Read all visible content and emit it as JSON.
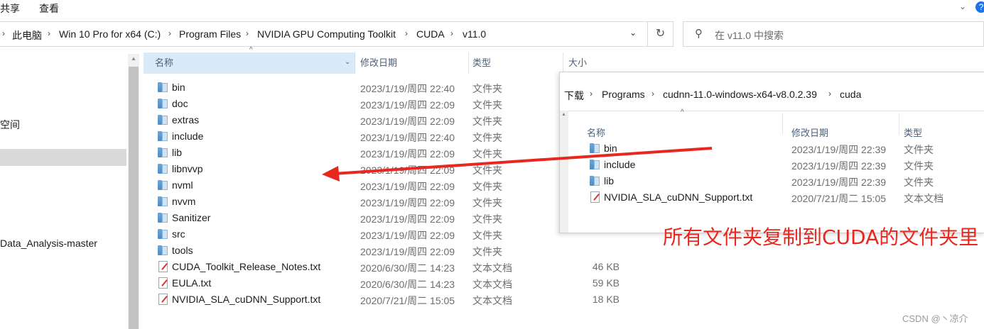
{
  "ribbon": {
    "tabs": [
      "共享",
      "查看"
    ]
  },
  "address": {
    "breadcrumbs": [
      "此电脑",
      "Win 10 Pro for x64 (C:)",
      "Program Files",
      "NVIDIA GPU Computing Toolkit",
      "CUDA",
      "v11.0"
    ],
    "search_placeholder": "在 v11.0 中搜索"
  },
  "nav": {
    "items": [
      "空间",
      "Data_Analysis-master"
    ]
  },
  "columns": {
    "name": "名称",
    "date": "修改日期",
    "type": "类型",
    "size": "大小"
  },
  "files": [
    {
      "name": "bin",
      "date": "2023/1/19/周四 22:40",
      "type": "文件夹",
      "size": "",
      "kind": "folder"
    },
    {
      "name": "doc",
      "date": "2023/1/19/周四 22:09",
      "type": "文件夹",
      "size": "",
      "kind": "folder"
    },
    {
      "name": "extras",
      "date": "2023/1/19/周四 22:09",
      "type": "文件夹",
      "size": "",
      "kind": "folder"
    },
    {
      "name": "include",
      "date": "2023/1/19/周四 22:40",
      "type": "文件夹",
      "size": "",
      "kind": "folder"
    },
    {
      "name": "lib",
      "date": "2023/1/19/周四 22:09",
      "type": "文件夹",
      "size": "",
      "kind": "folder"
    },
    {
      "name": "libnvvp",
      "date": "2023/1/19/周四 22:09",
      "type": "文件夹",
      "size": "",
      "kind": "folder"
    },
    {
      "name": "nvml",
      "date": "2023/1/19/周四 22:09",
      "type": "文件夹",
      "size": "",
      "kind": "folder"
    },
    {
      "name": "nvvm",
      "date": "2023/1/19/周四 22:09",
      "type": "文件夹",
      "size": "",
      "kind": "folder"
    },
    {
      "name": "Sanitizer",
      "date": "2023/1/19/周四 22:09",
      "type": "文件夹",
      "size": "",
      "kind": "folder"
    },
    {
      "name": "src",
      "date": "2023/1/19/周四 22:09",
      "type": "文件夹",
      "size": "",
      "kind": "folder"
    },
    {
      "name": "tools",
      "date": "2023/1/19/周四 22:09",
      "type": "文件夹",
      "size": "",
      "kind": "folder"
    },
    {
      "name": "CUDA_Toolkit_Release_Notes.txt",
      "date": "2020/6/30/周二 14:23",
      "type": "文本文档",
      "size": "46 KB",
      "kind": "txt"
    },
    {
      "name": "EULA.txt",
      "date": "2020/6/30/周二 14:23",
      "type": "文本文档",
      "size": "59 KB",
      "kind": "txt"
    },
    {
      "name": "NVIDIA_SLA_cuDNN_Support.txt",
      "date": "2020/7/21/周二 15:05",
      "type": "文本文档",
      "size": "18 KB",
      "kind": "txt"
    }
  ],
  "overlay": {
    "breadcrumbs": [
      "下载",
      "Programs",
      "cudnn-11.0-windows-x64-v8.0.2.39",
      "cuda"
    ],
    "columns": {
      "name": "名称",
      "date": "修改日期",
      "type": "类型"
    },
    "files": [
      {
        "name": "bin",
        "date": "2023/1/19/周四 22:39",
        "type": "文件夹",
        "kind": "folder"
      },
      {
        "name": "include",
        "date": "2023/1/19/周四 22:39",
        "type": "文件夹",
        "kind": "folder"
      },
      {
        "name": "lib",
        "date": "2023/1/19/周四 22:39",
        "type": "文件夹",
        "kind": "folder"
      },
      {
        "name": "NVIDIA_SLA_cuDNN_Support.txt",
        "date": "2020/7/21/周二 15:05",
        "type": "文本文档",
        "kind": "txt"
      }
    ]
  },
  "annotation": {
    "text": "所有文件夹复制到CUDA的文件夹里",
    "color": "#e8281f"
  },
  "watermark": "CSDN @丶凉介"
}
